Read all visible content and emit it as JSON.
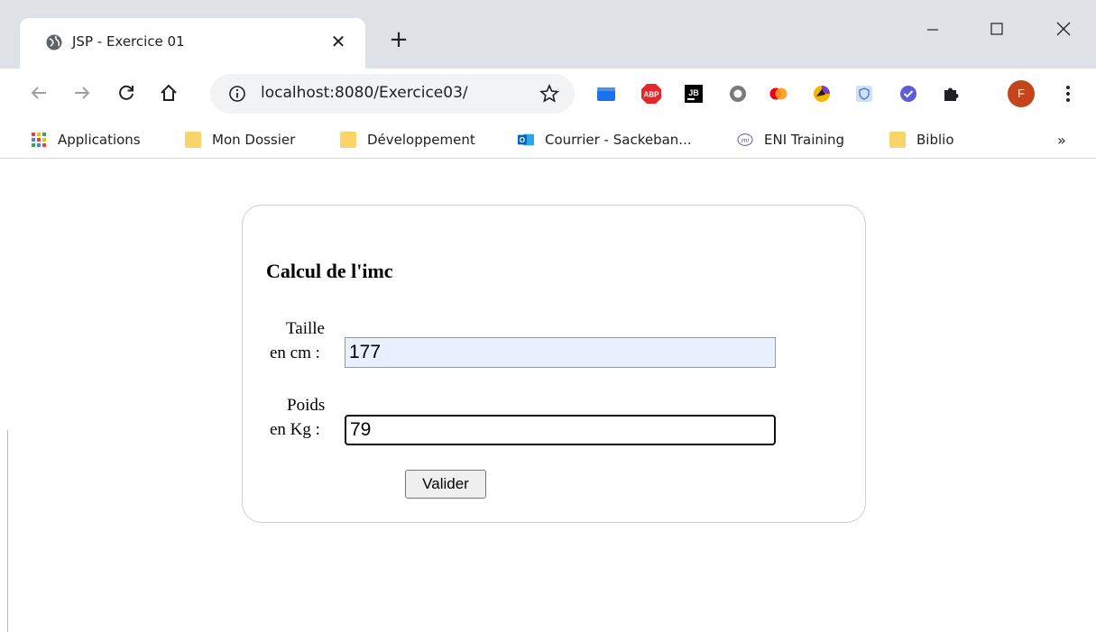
{
  "tab": {
    "title": "JSP - Exercice 01",
    "close": "✕"
  },
  "new_tab": "+",
  "omnibox": {
    "url": "localhost:8080/Exercice03/"
  },
  "profile": {
    "initial": "F",
    "color": "#c5441b"
  },
  "bookmarks": {
    "items": [
      {
        "label": "Applications",
        "icon": "apps-grid-icon"
      },
      {
        "label": "Mon Dossier",
        "icon": "folder-icon"
      },
      {
        "label": "Développement",
        "icon": "folder-icon"
      },
      {
        "label": "Courrier - Sackeban...",
        "icon": "outlook-icon"
      },
      {
        "label": "ENI Training",
        "icon": "eni-icon"
      },
      {
        "label": "Biblio",
        "icon": "folder-icon"
      }
    ],
    "more": "»"
  },
  "form": {
    "heading": "Calcul de l'imc",
    "taille_label_1": "Taille",
    "taille_label_2": "en cm :",
    "taille_value": "177",
    "poids_label_1": "Poids",
    "poids_label_2": "en Kg :",
    "poids_value": "79",
    "submit_label": "Valider"
  },
  "colors": {
    "titlebar": "#dee1e6",
    "autofill": "#e8f0fe",
    "folder": "#f9d468"
  }
}
